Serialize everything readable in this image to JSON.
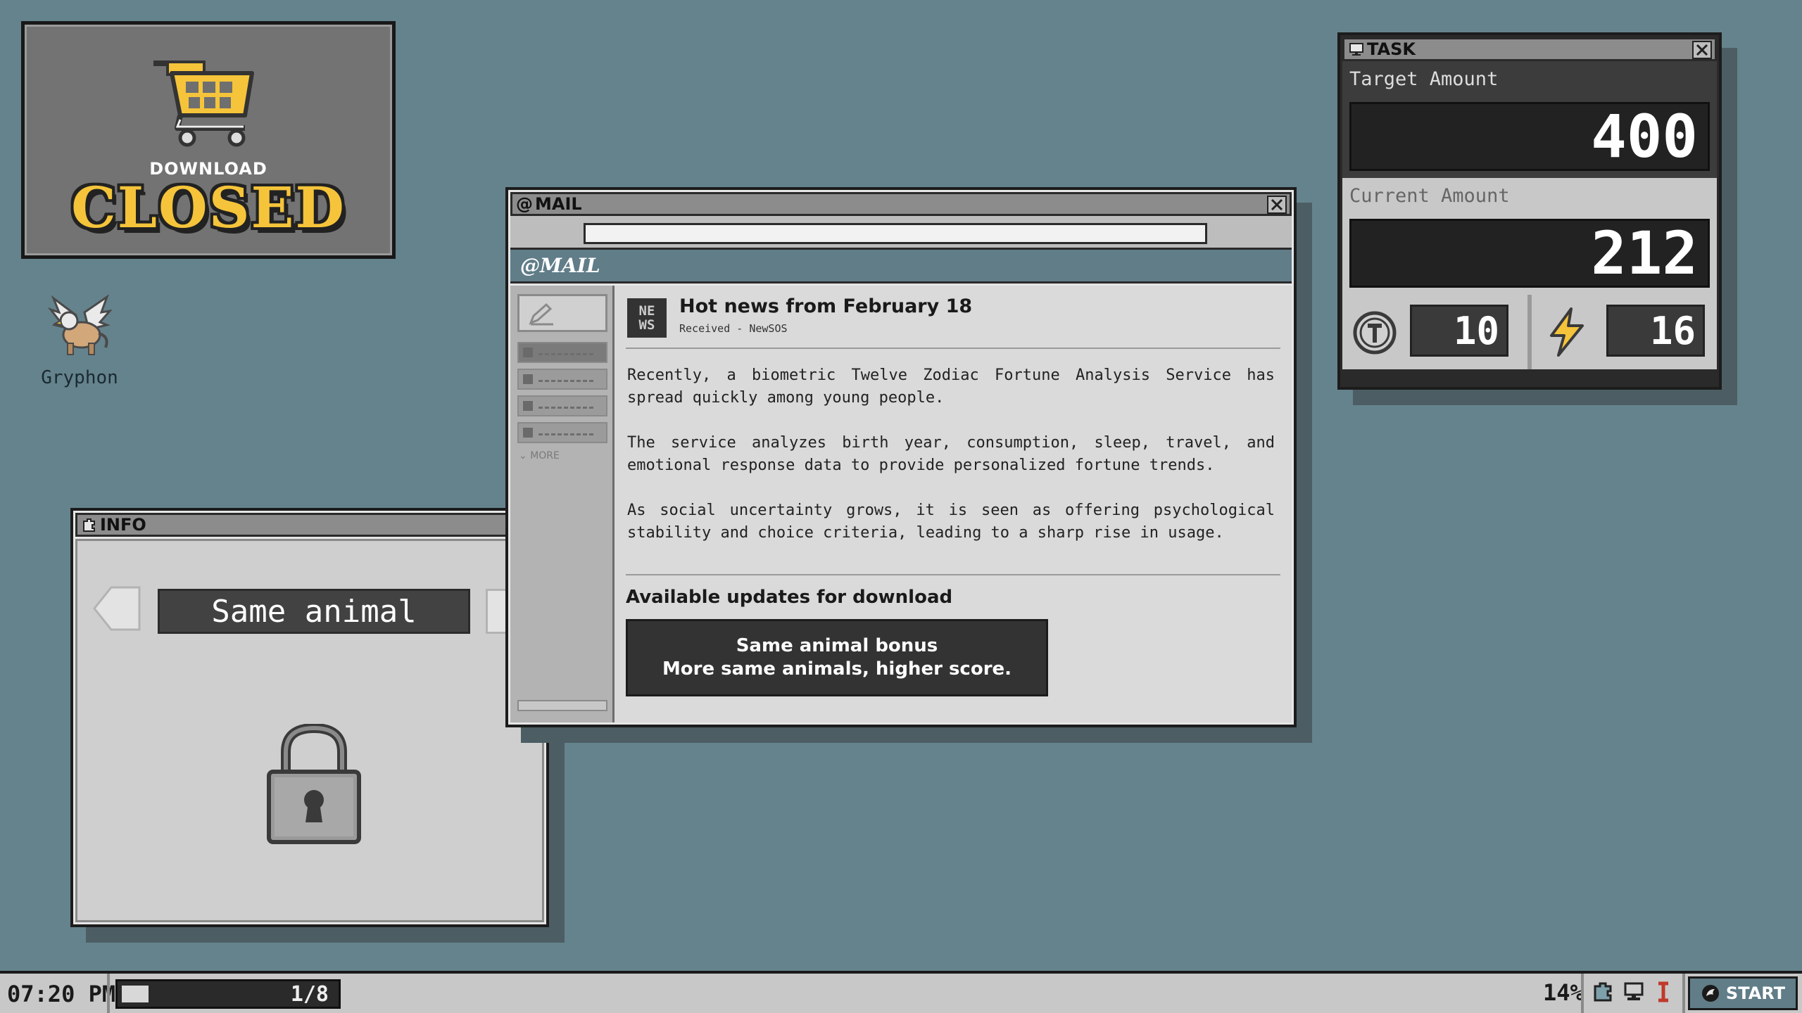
{
  "desktop": {
    "shop": {
      "download_label": "DOWNLOAD",
      "status_label": "CLOSED"
    },
    "icons": [
      {
        "label": "Gryphon",
        "icon": "gryphon-icon"
      }
    ]
  },
  "info_window": {
    "title": "INFO",
    "selector_label": "Same animal",
    "icon": "puzzle-icon",
    "content_icon": "padlock-icon"
  },
  "mail_window": {
    "title": "MAIL",
    "brand": "@MAIL",
    "address_value": "",
    "sidebar_more": "MORE",
    "message": {
      "icon_text_1": "NE",
      "icon_text_2": "WS",
      "subject": "Hot news from February 18",
      "received": "Received - NewSOS",
      "paragraphs": [
        "Recently, a biometric Twelve Zodiac Fortune Analysis Service has spread quickly among young people.",
        "The service analyzes birth year, consumption, sleep, travel, and emotional response data to provide personalized fortune trends.",
        "As social uncertainty grows, it is seen as offering psychological stability and choice criteria, leading to a sharp rise in usage."
      ],
      "updates_heading": "Available updates for download",
      "update_button_line1": "Same animal bonus",
      "update_button_line2": "More same animals, higher score."
    }
  },
  "task_window": {
    "title": "TASK",
    "target_label": "Target Amount",
    "target_value": "400",
    "current_label": "Current Amount",
    "current_value": "212",
    "token_value": "10",
    "energy_value": "16",
    "colors": {
      "energy": "#f5c43a"
    }
  },
  "taskbar": {
    "time": "07:20 PM",
    "progress_text": "1/8",
    "progress_fraction": 0.125,
    "percent": "14%",
    "start_label": "START"
  },
  "colors": {
    "desktop": "#65838d",
    "accent": "#607d88",
    "closed_text": "#f5c43a"
  }
}
